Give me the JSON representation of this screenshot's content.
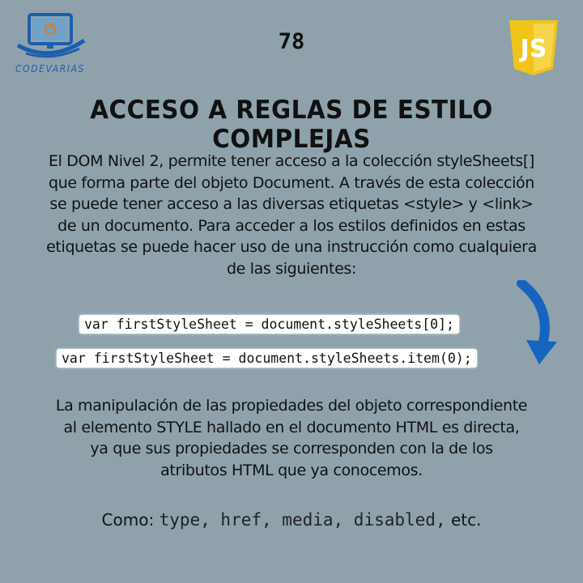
{
  "header": {
    "logo_text": "CODEVARIAS",
    "page_number": "78",
    "js_badge": "JS"
  },
  "title": "ACCESO A REGLAS DE ESTILO COMPLEJAS",
  "intro": {
    "line1": "El DOM Nivel 2, permite tener acceso a la colección styleSheets[]",
    "line2": "que forma parte del objeto Document. A través de esta colección",
    "line3": "se puede tener acceso a las diversas etiquetas <style> y <link>",
    "line4": "de un documento. Para acceder a los estilos definidos en estas",
    "line5": "etiquetas se puede hacer uso de una instrucción como cualquiera",
    "line6": "de las siguientes:"
  },
  "code": {
    "line1": "var firstStyleSheet = document.styleSheets[0];",
    "line2": "var firstStyleSheet = document.styleSheets.item(0);"
  },
  "body": {
    "line1": "La manipulación de las propiedades del objeto correspondiente",
    "line2": "al elemento STYLE hallado en el documento HTML es directa,",
    "line3": "ya que sus propiedades se corresponden con la de los",
    "line4": "atributos HTML que ya conocemos."
  },
  "como": {
    "label": "Como:",
    "items": "type, href, media, disabled,",
    "etc": "etc."
  },
  "colors": {
    "background": "#8fa2ac",
    "logo_blue": "#1b5fae",
    "js_yellow": "#f0c419",
    "arrow_blue": "#1565c0"
  },
  "icons": {
    "logo": "computer-monitor-icon",
    "badge": "js-shield-icon",
    "arrow": "curved-arrow-down-icon"
  }
}
